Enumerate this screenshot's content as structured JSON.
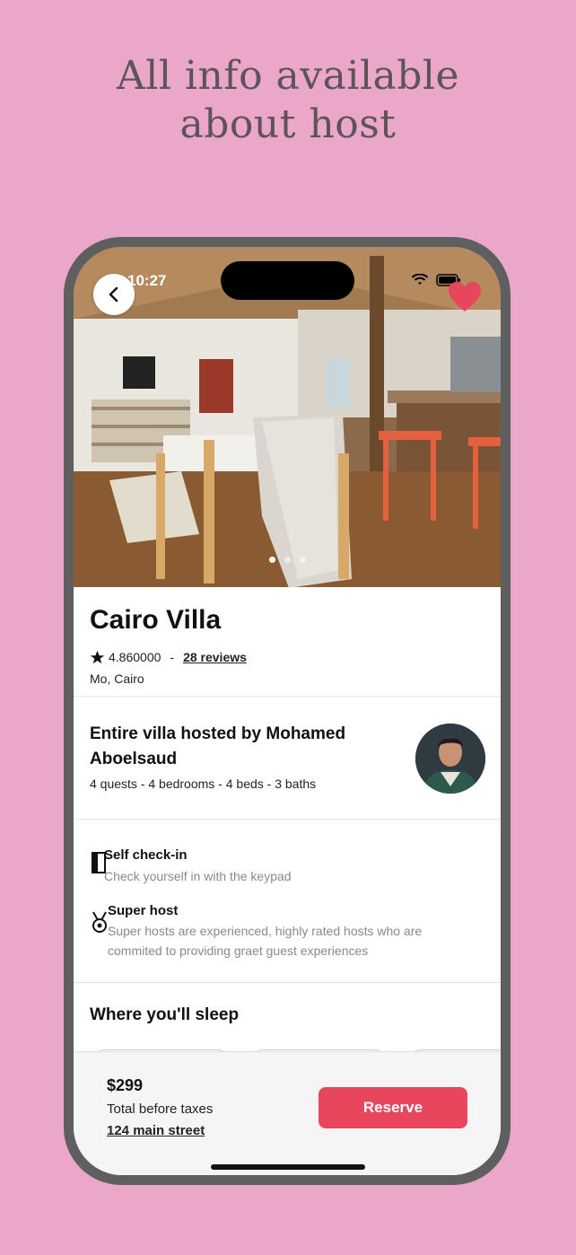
{
  "headline": {
    "line1": "All info available",
    "line2": "about host"
  },
  "status_bar": {
    "time": "10:27"
  },
  "listing": {
    "title": "Cairo Villa",
    "rating": "4.860000",
    "separator": "-",
    "reviews_label": "28 reviews",
    "location": "Mo, Cairo",
    "host_title": "Entire villa hosted by Mohamed Aboelsaud",
    "details": "4 quests - 4 bedrooms - 4 beds - 3 baths",
    "photo_pages": 3,
    "photo_current": 1
  },
  "features": [
    {
      "title": "Self check-in",
      "description": "Check yourself in with the keypad",
      "icon": "door-icon"
    },
    {
      "title": "Super host",
      "description": "Super hosts are experienced, highly rated hosts who are commited to providing graet guest experiences",
      "icon": "medal-icon"
    }
  ],
  "sleep": {
    "title": "Where you'll sleep"
  },
  "booking": {
    "price": "$299",
    "price_note": "Total before taxes",
    "address": "124 main street",
    "reserve_label": "Reserve"
  },
  "colors": {
    "background": "#eba7c9",
    "accent": "#e8465d",
    "heart": "#e8465d",
    "phone_frame": "#5f5f5f"
  }
}
